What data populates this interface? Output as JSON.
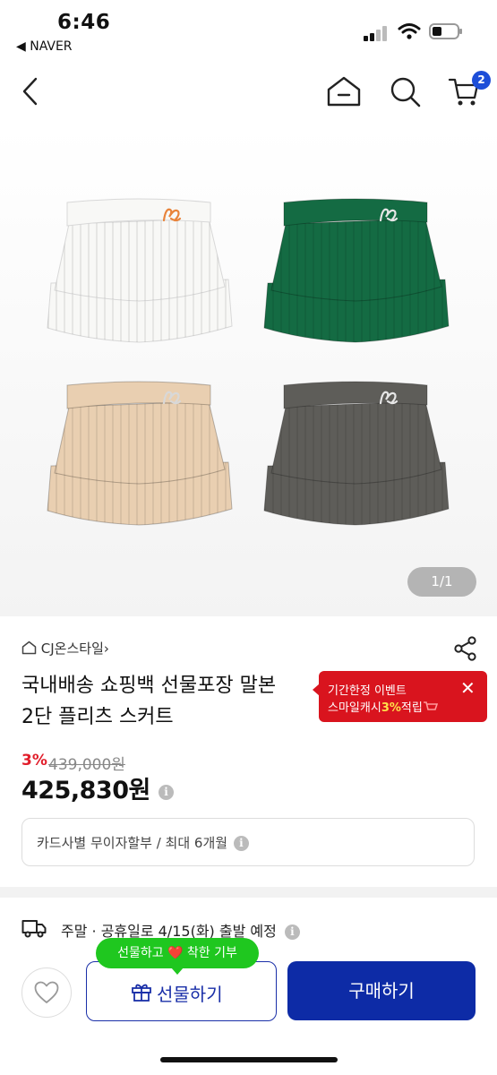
{
  "status_bar": {
    "time": "6:46",
    "back_app": "◀ NAVER"
  },
  "nav": {
    "cart_count": "2",
    "icons": [
      "back-chevron-icon",
      "home-icon",
      "search-icon",
      "cart-icon"
    ]
  },
  "gallery": {
    "counter": "1/1",
    "skirt_colors": [
      "#f8f8f6",
      "#146b43",
      "#e9cfb1",
      "#5e5d59"
    ],
    "logo_colors": [
      "#e8833a",
      "#e6e6e6",
      "#d8d8d8",
      "#e6e6e6"
    ]
  },
  "store": {
    "name": "CJ온스타일",
    "chevron": "›"
  },
  "product": {
    "title_line1": "국내배송 쇼핑백 선물포장 말본",
    "title_line2": "2단 플리츠 스커트",
    "discount": "3%",
    "original_price": "439,000원",
    "price": "425,830원"
  },
  "promo": {
    "line1": "기간한정 이벤트",
    "line2_prefix": "스마일캐시",
    "line2_highlight": "3%",
    "line2_suffix": "적립",
    "close": "✕"
  },
  "installment": {
    "text": "카드사별 무이자할부 / 최대 6개월"
  },
  "shipping": {
    "text": "주말 · 공휴일로 4/15(화) 출발 예정"
  },
  "info_glyph": "i",
  "bottom": {
    "gift_tip": "선물하고 ❤️ 착한 기부",
    "gift_label": "선물하기",
    "buy_label": "구매하기"
  },
  "colors": {
    "accent": "#0d2ba6",
    "sale_red": "#e11d2a",
    "promo_red": "#d9141e",
    "tip_green": "#1fc71f"
  }
}
